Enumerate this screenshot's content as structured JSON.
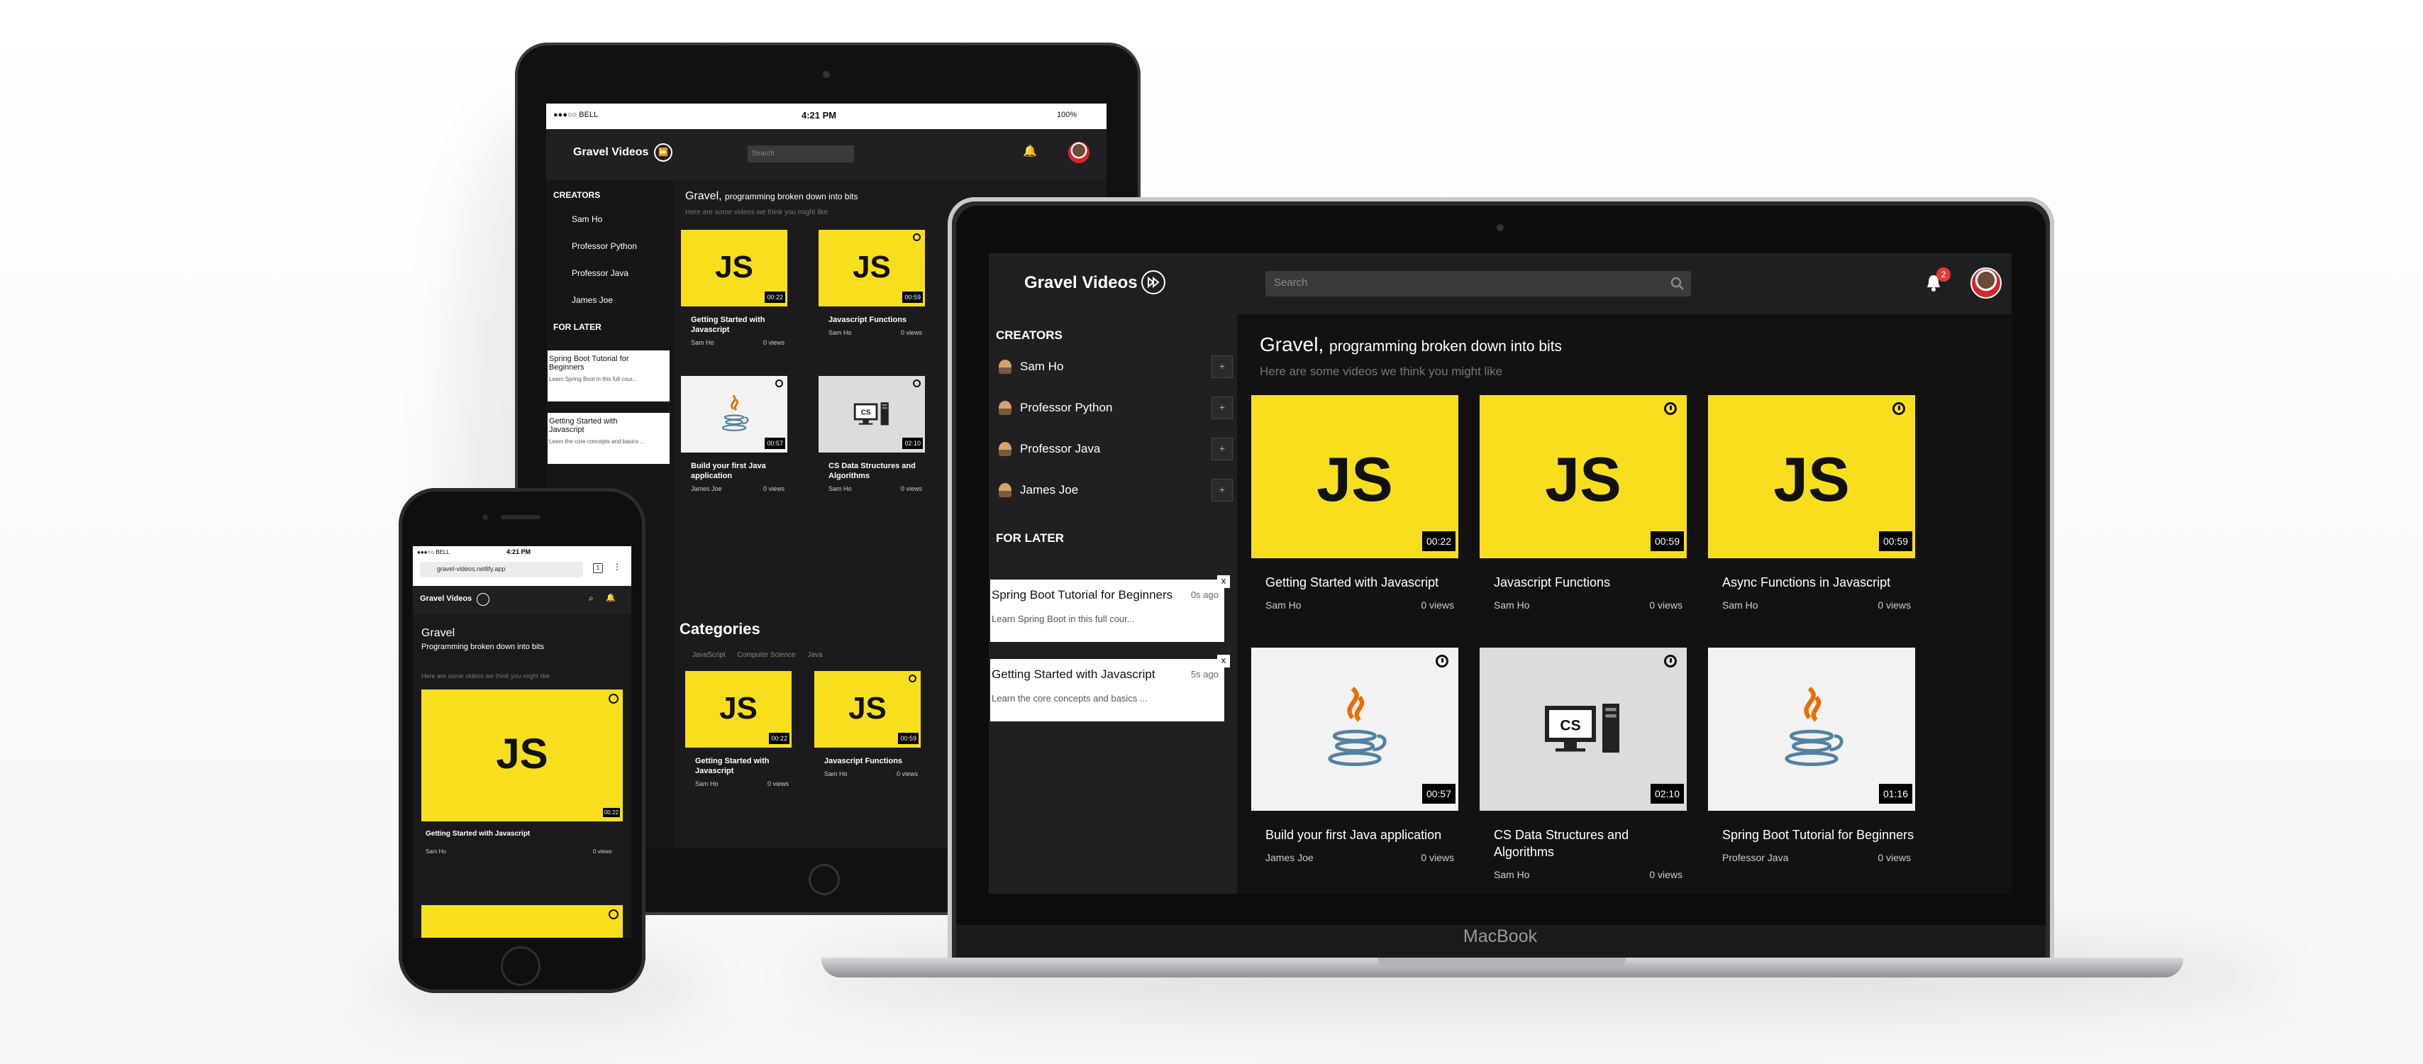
{
  "app": {
    "name": "Gravel Videos",
    "heading": "Gravel",
    "tagline": "programming broken down into bits",
    "heading_sep": ",",
    "subtitle": "Here are some videos we think you might like",
    "search_placeholder": "Search",
    "notification_count": "2"
  },
  "sidebar": {
    "creators_heading": "CREATORS",
    "creators": [
      {
        "name": "Sam Ho",
        "add": "+"
      },
      {
        "name": "Professor Python",
        "add": "+"
      },
      {
        "name": "Professor Java",
        "add": "+"
      },
      {
        "name": "James Joe",
        "add": "+"
      }
    ],
    "later_heading": "FOR LATER",
    "later": [
      {
        "title": "Spring Boot Tutorial for Beginners",
        "time": "0s ago",
        "desc": "Learn Spring Boot in this full cour...",
        "close": "x"
      },
      {
        "title": "Getting Started with Javascript",
        "time": "5s ago",
        "desc": "Learn the core concepts and basics ...",
        "close": "x"
      }
    ]
  },
  "videos": [
    {
      "title": "Getting Started with Javascript",
      "channel": "Sam Ho",
      "views": "0 views",
      "duration": "00:22",
      "thumb": "js",
      "label": "JS",
      "later": false
    },
    {
      "title": "Javascript Functions",
      "channel": "Sam Ho",
      "views": "0 views",
      "duration": "00:59",
      "thumb": "js",
      "label": "JS",
      "later": true
    },
    {
      "title": "Async Functions in Javascript",
      "channel": "Sam Ho",
      "views": "0 views",
      "duration": "00:59",
      "thumb": "js",
      "label": "JS",
      "later": true
    },
    {
      "title": "Build your first Java application",
      "channel": "James Joe",
      "views": "0 views",
      "duration": "00:57",
      "thumb": "java",
      "label": "",
      "later": true
    },
    {
      "title": "CS Data Structures and Algorithms",
      "channel": "Sam Ho",
      "views": "0 views",
      "duration": "02:10",
      "thumb": "cs",
      "label": "CS",
      "later": true
    },
    {
      "title": "Spring Boot Tutorial for Beginners",
      "channel": "Professor Java",
      "views": "0 views",
      "duration": "01:16",
      "thumb": "java",
      "label": "",
      "later": false
    }
  ],
  "tablet": {
    "status_carrier": "●●●○○ BELL",
    "status_time": "4:21 PM",
    "status_battery": "100%",
    "later": [
      {
        "title": "Spring Boot Tutorial for Beginners",
        "time": "0s ago",
        "desc": "Learn Spring Boot in this full cour..."
      },
      {
        "title": "Getting Started with Javascript",
        "time": "5s ago",
        "desc": "Learn the core concepts and basics ..."
      }
    ],
    "tablet_videos": [
      {
        "title": "Getting Started with Javascript",
        "channel": "Sam Ho",
        "views": "0 views",
        "duration": "00:22"
      },
      {
        "title": "Javascript Functions",
        "channel": "Sam Ho",
        "views": "0 views",
        "duration": "00:59"
      },
      {
        "title": "Build your first Java application",
        "channel": "James Joe",
        "views": "0 views",
        "duration": "00:57"
      },
      {
        "title": "CS Data Structures and Algorithms",
        "channel": "Sam Ho",
        "views": "0 views",
        "duration": "02:10"
      }
    ],
    "categories_heading": "Categories",
    "categories": [
      "JavaScript",
      "Computer Science",
      "Java"
    ],
    "category_videos": [
      {
        "title": "Getting Started with Javascript",
        "channel": "Sam Ho",
        "views": "0 views",
        "duration": "00:22"
      },
      {
        "title": "Javascript Functions",
        "channel": "Sam Ho",
        "views": "0 views",
        "duration": "00:59"
      }
    ]
  },
  "phone": {
    "status_carrier": "●●●○○ BELL",
    "status_time": "4:21 PM",
    "url": "gravel-videos.netlify.app",
    "heading": "Gravel",
    "tagline": "Programming broken down into bits",
    "subtitle": "Here are some videos we think you might like",
    "video": {
      "title": "Getting Started with Javascript",
      "channel": "Sam Ho",
      "views": "0 views",
      "duration": "00:22",
      "label": "JS"
    }
  },
  "device_brand": "MacBook",
  "colors": {
    "accent_yellow": "#f7df1e",
    "bg_dark": "#121212",
    "badge_red": "#e53935"
  }
}
